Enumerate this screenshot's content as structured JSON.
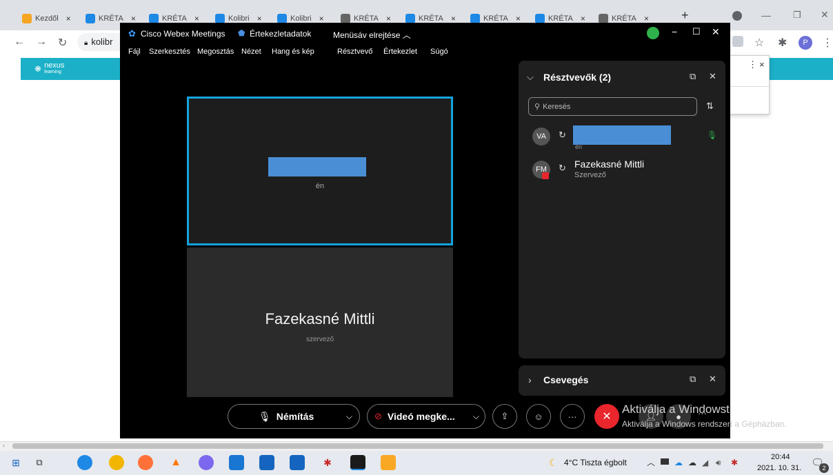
{
  "browser": {
    "tabs": [
      {
        "label": "Kezdől",
        "color": "#f5a623"
      },
      {
        "label": "KRÉTA",
        "color": "#1e88e5"
      },
      {
        "label": "KRÉTA",
        "color": "#1e88e5"
      },
      {
        "label": "Kolibri",
        "color": "#1e88e5"
      },
      {
        "label": "Kolibri",
        "color": "#1e88e5"
      },
      {
        "label": "KRÉTA",
        "color": "#666666"
      },
      {
        "label": "KRÉTA",
        "color": "#1e88e5"
      },
      {
        "label": "KRÉTA",
        "color": "#1e88e5"
      },
      {
        "label": "KRÉTA",
        "color": "#1e88e5"
      },
      {
        "label": "KRÉTA",
        "color": "#666666"
      }
    ],
    "tab_close": "×",
    "new_tab": "+",
    "address": "kolibr",
    "profile_initial": "P"
  },
  "nexus": {
    "logo_line1": "nexus",
    "logo_line2": "learning",
    "popup_close": "×"
  },
  "webex": {
    "app_title": "Cisco Webex Meetings",
    "meeting_info": "Értekezletadatok",
    "hide_menu": "Menüsáv elrejtése",
    "menu": [
      "Fájl",
      "Szerkesztés",
      "Megosztás",
      "Nézet",
      "Hang és kép",
      "Résztvevő",
      "Értekezlet",
      "Súgó"
    ],
    "tile_self_sub": "én",
    "tile_other_name": "Fazekasné Mittli",
    "tile_other_role": "szervező",
    "participants_title": "Résztvevők (2)",
    "search_placeholder": "Keresés",
    "participants": [
      {
        "initials": "VA",
        "name": "",
        "sub": "én"
      },
      {
        "initials": "FM",
        "name": "Fazekasné Mittli",
        "sub": "Szervező"
      }
    ],
    "chat_title": "Csevegés",
    "mute_label": "Némítás",
    "video_label": "Videó megke...",
    "more_label": "···"
  },
  "windows": {
    "activate_title": "Aktiválja a Windowst",
    "activate_sub": "Aktiválja a Windows rendszert a Gépházban.",
    "weather": "4°C  Tiszta égbolt",
    "time": "20:44",
    "date": "2021. 10. 31.",
    "notif_count": "2"
  },
  "colors": {
    "webex_accent": "#14a4df",
    "leave_red": "#e8262c",
    "nexus_teal": "#1bb0c7",
    "mic_green": "#2fb24c"
  }
}
